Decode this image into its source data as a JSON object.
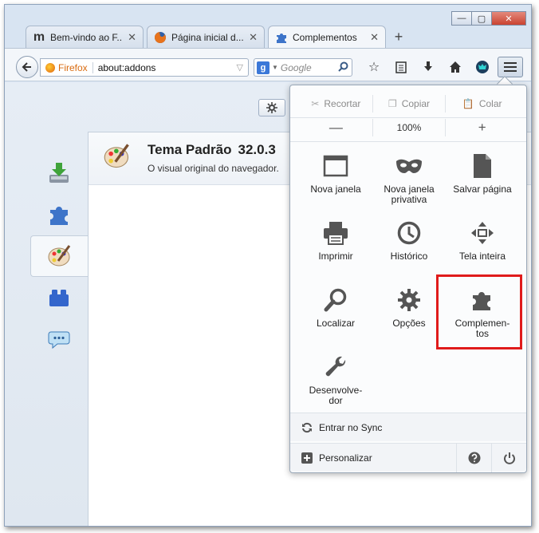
{
  "window": {
    "controls": {
      "minimize": "—",
      "maximize": "▢",
      "close": "✕"
    }
  },
  "tabs": [
    {
      "title": "Bem-vindo ao F...",
      "icon": "m-site-icon",
      "close": "✕"
    },
    {
      "title": "Página inicial d...",
      "icon": "firefox-icon",
      "close": "✕"
    },
    {
      "title": "Complementos",
      "icon": "puzzle-icon",
      "close": "✕"
    }
  ],
  "new_tab": "+",
  "navbar": {
    "identity": "Firefox",
    "url": "about:addons",
    "search_engine": "g",
    "search_placeholder": "Google"
  },
  "addon": {
    "name": "Tema Padrão",
    "version": "32.0.3",
    "description": "O visual original do navegador."
  },
  "menu": {
    "edit": {
      "cut": "Recortar",
      "copy": "Copiar",
      "paste": "Colar"
    },
    "zoom": {
      "minus": "—",
      "level": "100%",
      "plus": "+"
    },
    "items": [
      {
        "label": "Nova janela",
        "icon": "new-window-icon"
      },
      {
        "label": "Nova janela privativa",
        "icon": "private-mask-icon"
      },
      {
        "label": "Salvar página",
        "icon": "save-page-icon"
      },
      {
        "label": "Imprimir",
        "icon": "printer-icon"
      },
      {
        "label": "Histórico",
        "icon": "clock-icon"
      },
      {
        "label": "Tela inteira",
        "icon": "fullscreen-arrows-icon"
      },
      {
        "label": "Localizar",
        "icon": "magnifier-icon"
      },
      {
        "label": "Opções",
        "icon": "gear-icon"
      },
      {
        "label": "Complemen-tos",
        "icon": "puzzle-icon"
      },
      {
        "label": "Desenvolve-dor",
        "icon": "wrench-icon"
      }
    ],
    "sync": "Entrar no Sync",
    "customize": "Personalizar"
  },
  "colors": {
    "highlight": "#e01b1b",
    "firefox_orange": "#d96b10",
    "page_bg": "#dfe7f0"
  }
}
